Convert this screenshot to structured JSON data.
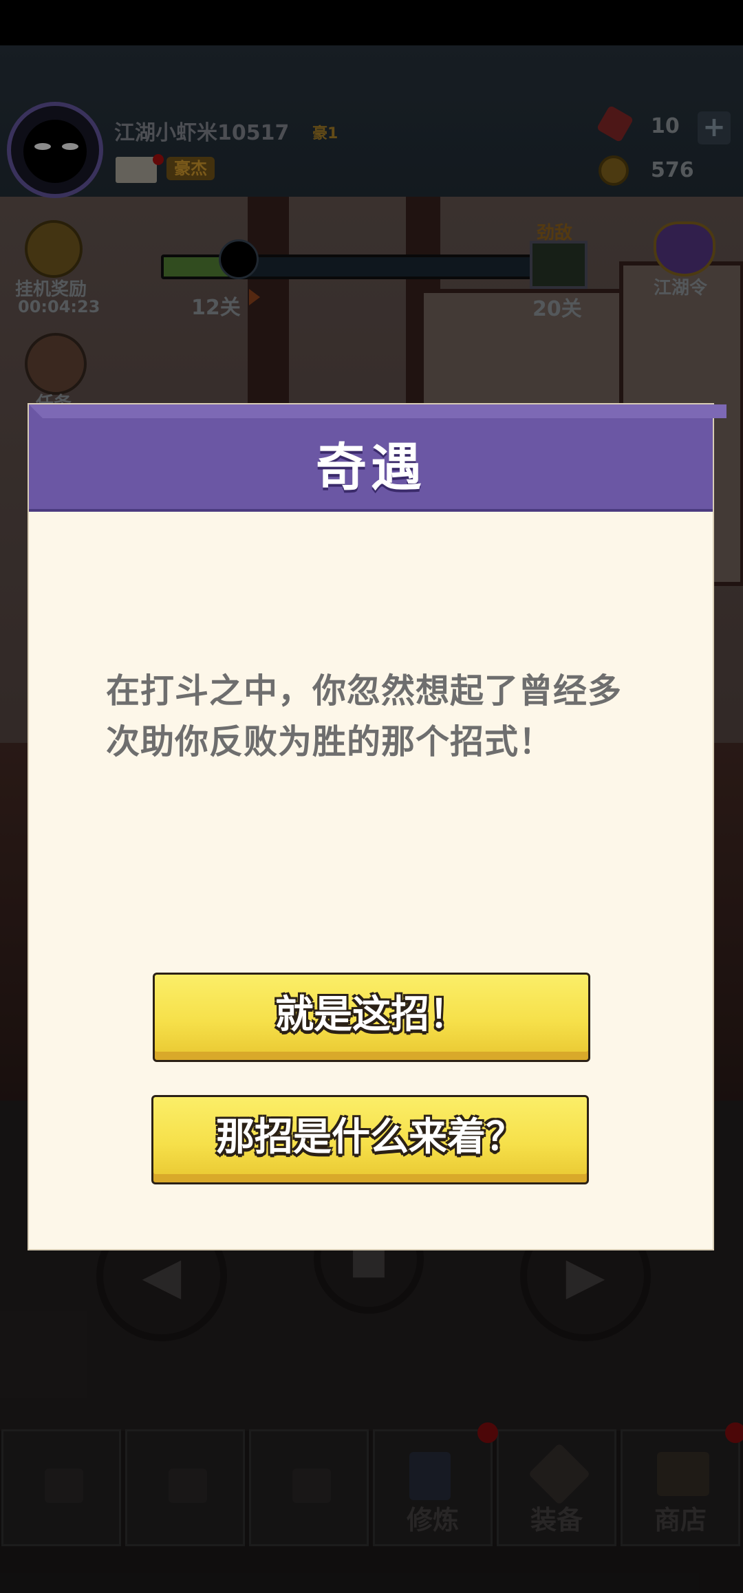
{
  "hud": {
    "player_name": "江湖小虾米10517",
    "vip_label": "豪1",
    "title_badge": "豪杰",
    "gems": "10",
    "gem_plus": "+",
    "coins": "576"
  },
  "progress": {
    "idle_reward_label": "挂机奖励",
    "idle_timer": "00:04:23",
    "current_stage": "12关",
    "enemy_badge": "劲敌",
    "target_stage": "20关",
    "token_label": "江湖令",
    "quest_label": "任务"
  },
  "dialog": {
    "title": "奇遇",
    "message": "在打斗之中，你忽然想起了曾经多次助你反败为胜的那个招式！",
    "option_1": "就是这招！",
    "option_2": "那招是什么来着？"
  },
  "bottom_nav": {
    "items": [
      {
        "label": ""
      },
      {
        "label": ""
      },
      {
        "label": ""
      },
      {
        "label": "修炼"
      },
      {
        "label": "装备"
      },
      {
        "label": "商店"
      }
    ]
  },
  "icons": {
    "gem": "red-gem-icon",
    "coin": "gold-coin-icon",
    "mail": "mail-icon",
    "lock": "lock-icon"
  },
  "colors": {
    "dialog_header": "#6b57a4",
    "dialog_body": "#fdf7e9",
    "button_yellow": "#f6e04a",
    "text_gray": "#6e6e6e"
  }
}
